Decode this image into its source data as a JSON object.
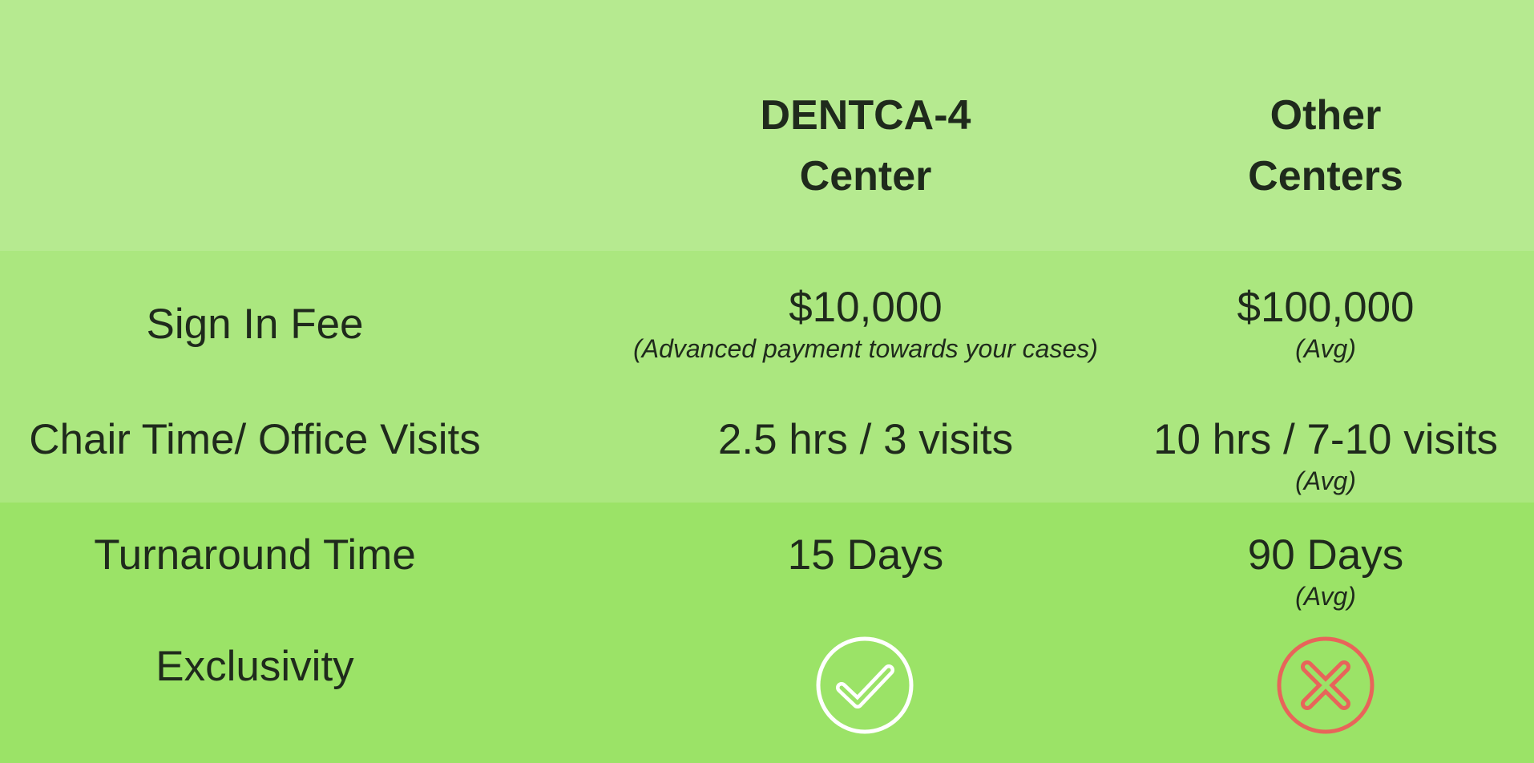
{
  "header": {
    "col2": [
      "DENTCA-4",
      "Center"
    ],
    "col3": [
      "Other",
      "Centers"
    ]
  },
  "rows": [
    {
      "label": "Sign In Fee",
      "dentca": {
        "value": "$10,000",
        "note": "(Advanced payment towards your cases)"
      },
      "other": {
        "value": "$100,000",
        "note": "(Avg)"
      }
    },
    {
      "label": "Chair Time/ Office Visits",
      "dentca": {
        "value": "2.5 hrs / 3 visits",
        "note": ""
      },
      "other": {
        "value": "10 hrs / 7-10 visits",
        "note": "(Avg)"
      }
    },
    {
      "label": "Turnaround Time",
      "dentca": {
        "value": "15 Days",
        "note": ""
      },
      "other": {
        "value": "90 Days",
        "note": "(Avg)"
      }
    },
    {
      "label": "Exclusivity",
      "dentca": {
        "icon": "check-circle-icon"
      },
      "other": {
        "icon": "x-circle-icon"
      }
    }
  ],
  "colors": {
    "band_top": "#b6ea90",
    "band_mid": "#abe77f",
    "band_bottom": "#9be367",
    "check": "#ffffff",
    "cross": "#e8645a"
  }
}
